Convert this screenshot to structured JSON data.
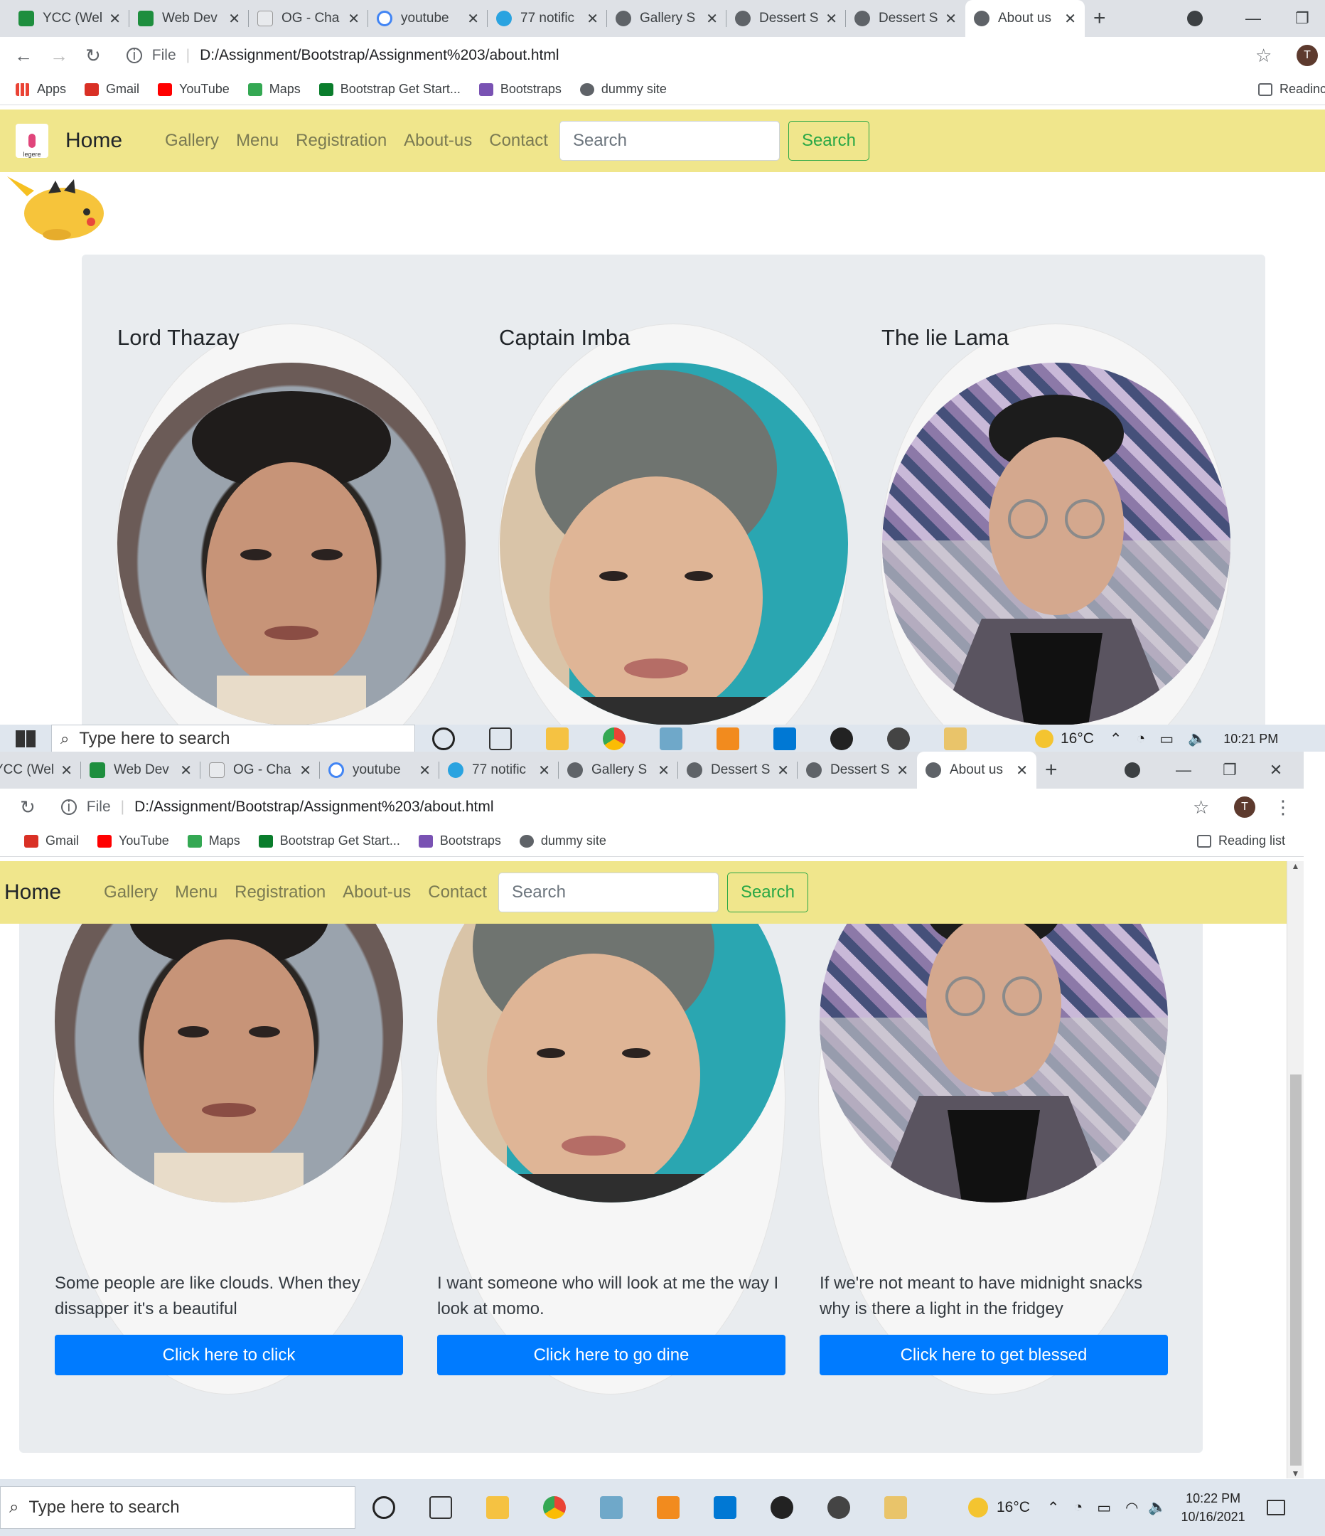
{
  "browser": {
    "tabs": [
      {
        "title": "YCC (Wel",
        "color": "#1e8e3e"
      },
      {
        "title": "Web Dev",
        "color": "#1e8e3e"
      },
      {
        "title": "OG - Cha",
        "color": "#5f6368"
      },
      {
        "title": "youtube",
        "color": "#4285f4"
      },
      {
        "title": "77 notific",
        "color": "#2aa3e0"
      },
      {
        "title": "Gallery S",
        "color": "#5f6368"
      },
      {
        "title": "Dessert S",
        "color": "#5f6368"
      },
      {
        "title": "Dessert S",
        "color": "#5f6368"
      },
      {
        "title": "About us",
        "color": "#5f6368"
      }
    ],
    "file_label": "File",
    "url": "D:/Assignment/Bootstrap/Assignment%203/about.html",
    "profile_initial": "T",
    "bookmarks": [
      {
        "label": "Apps",
        "color": "#ea4335"
      },
      {
        "label": "Gmail",
        "color": "#d93025"
      },
      {
        "label": "YouTube",
        "color": "#ff0000"
      },
      {
        "label": "Maps",
        "color": "#34a853"
      },
      {
        "label": "Bootstrap Get Start...",
        "color": "#0a7d2c"
      },
      {
        "label": "Bootstraps",
        "color": "#7952b3"
      },
      {
        "label": "dummy site",
        "color": "#5f6368"
      }
    ],
    "reading_list_top": "Readinc",
    "reading_list": "Reading list"
  },
  "navbar": {
    "logo_text": "legere",
    "brand": "Home",
    "links": [
      "Gallery",
      "Menu",
      "Registration",
      "About-us",
      "Contact"
    ],
    "search_placeholder": "Search",
    "search_button": "Search",
    "bg_color": "#f0e68c"
  },
  "team": [
    {
      "name": "Lord Thazay",
      "quote": "Some people are like clouds. When they dissapper it's a beautiful",
      "button": "Click here to click"
    },
    {
      "name": "Captain Imba",
      "quote": "I want someone who will look at me the way I look at momo.",
      "button": "Click here to go dine"
    },
    {
      "name": "The lie Lama",
      "quote": "If we're not meant to have midnight snacks why is there a light in the fridgey",
      "button": "Click here to get blessed"
    }
  ],
  "taskbar_top": {
    "search_placeholder": "Type here to search",
    "temperature": "16°C",
    "time": "10:21 PM"
  },
  "taskbar_bottom": {
    "search_placeholder": "Type here to search",
    "temperature": "16°C",
    "time": "10:22 PM",
    "date": "10/16/2021"
  },
  "colors": {
    "primary": "#007bff",
    "success": "#28a745",
    "jumbotron": "#e9ecef"
  }
}
